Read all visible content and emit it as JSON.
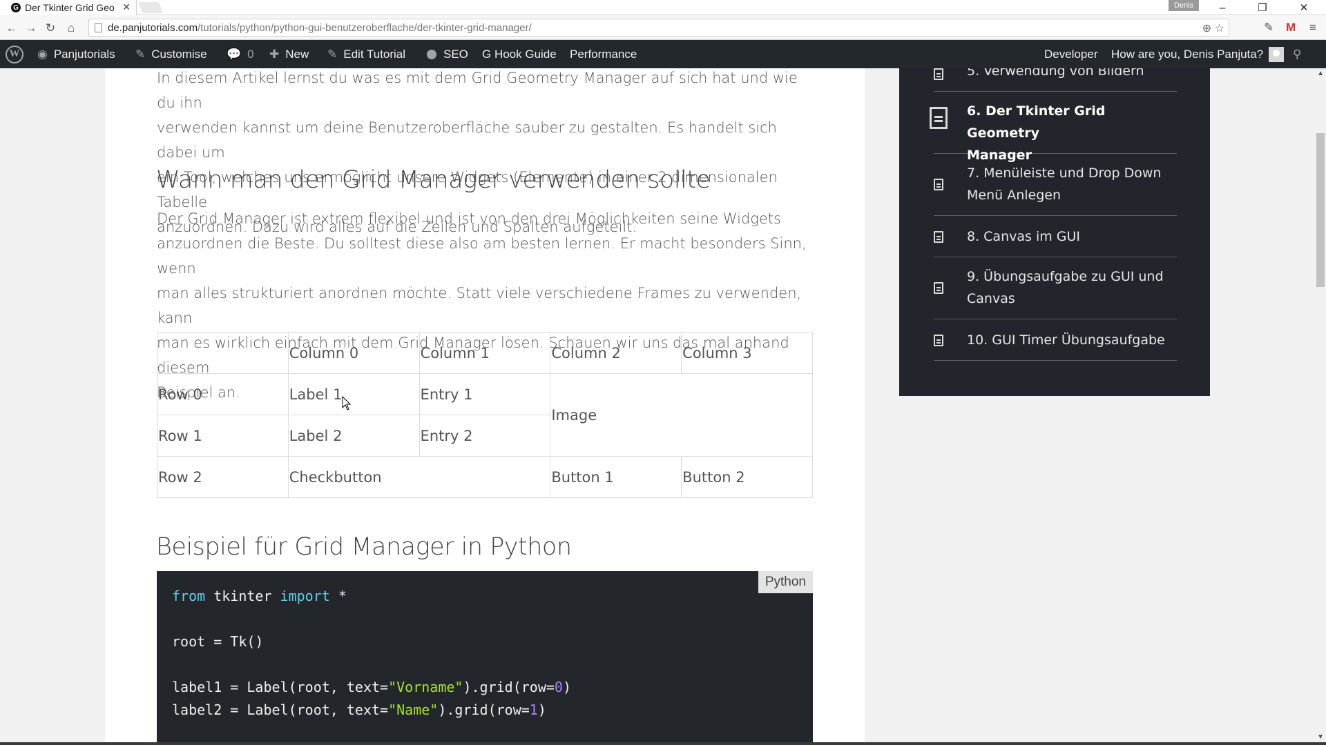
{
  "browser": {
    "tab_title": "Der Tkinter Grid Geo",
    "favicon_letter": "G",
    "profile_name": "Denis",
    "url_host": "de.panjutorials.com",
    "url_path": "/tutorials/python/python-gui-benutzeroberflache/der-tkinter-grid-manager/"
  },
  "adminbar": {
    "site_name": "Panjutorials",
    "customise": "Customise",
    "comments_count": "0",
    "new": "New",
    "edit": "Edit Tutorial",
    "seo": "SEO",
    "hook_guide": "G Hook Guide",
    "performance": "Performance",
    "developer": "Developer",
    "greeting": "How are you, Denis Panjuta?"
  },
  "article": {
    "intro": "In diesem Artikel lernst du was es mit dem Grid Geometry Manager auf sich hat und wie du ihn verwenden kannst um deine Benutzeroberfläche sauber zu gestalten. Es handelt sich dabei um ein Tool, welches uns ermöglicht unsere Widgets (Elemente) in einer 2 dimensionalen Tabelle anzuordnen. Dazu wird alles auf die Zeilen und Spalten aufgeteilt.",
    "intro_lines": [
      "In diesem Artikel lernst du was es mit dem Grid Geometry Manager auf sich hat und wie du ihn",
      "verwenden kannst um deine Benutzeroberfläche sauber zu gestalten. Es handelt sich dabei um",
      "ein Tool, welches uns ermöglicht unsere Widgets (Elemente) in einer 2 dimensionalen Tabelle",
      "anzuordnen. Dazu wird alles auf die Zeilen und Spalten aufgeteilt."
    ],
    "heading1": "Wann man den Grid Manager verwenden sollte",
    "para2_lines": [
      "Der Grid Manager ist extrem flexibel und ist von den drei Möglichkeiten seine Widgets",
      "anzuordnen die Beste. Du solltest diese also am besten lernen. Er macht besonders Sinn, wenn",
      "man alles strukturiert anordnen möchte. Statt viele verschiedene Frames zu verwenden, kann",
      "man es wirklich einfach mit dem Grid Manager lösen. Schauen wir uns das mal anhand diesem",
      "Beispiel an."
    ],
    "table": {
      "header": [
        "",
        "Column 0",
        "Column 1",
        "Column 2",
        "Column 3"
      ],
      "row0": [
        "Row 0",
        "Label 1",
        "Entry 1",
        "Image"
      ],
      "row1": [
        "Row 1",
        "Label 2",
        "Entry 2"
      ],
      "row2": [
        "Row 2",
        "Checkbutton",
        "Button 1",
        "Button 2"
      ]
    },
    "heading2": "Beispiel für Grid Manager in Python",
    "code_lang": "Python",
    "code": {
      "l1_from": "from",
      "l1_mod": " tkinter ",
      "l1_import": "import",
      "l1_rest": " *",
      "l2": "root = Tk()",
      "l3_a": "label1 = Label(root, text=",
      "l3_str": "\"Vorname\"",
      "l3_b": ").grid(row=",
      "l3_num": "0",
      "l3_c": ")",
      "l4_a": "label2 = Label(root, text=",
      "l4_str": "\"Name\"",
      "l4_b": ").grid(row=",
      "l4_num": "1",
      "l4_c": ")"
    }
  },
  "sidebar": {
    "items": [
      {
        "label": "5. Verwendung von Bildern"
      },
      {
        "label_l1": "6. Der Tkinter Grid Geometry",
        "label_l2": "Manager"
      },
      {
        "label_l1": "7. Menüleiste und Drop Down",
        "label_l2": "Menü Anlegen"
      },
      {
        "label": "8. Canvas im GUI"
      },
      {
        "label_l1": "9. Übungsaufgabe zu GUI und",
        "label_l2": "Canvas"
      },
      {
        "label": "10. GUI Timer Übungsaufgabe"
      }
    ]
  },
  "colors": {
    "adminbar": "#23282d",
    "sidebar": "#22262c",
    "code_bg": "#23262b",
    "keyword": "#5ed1e8",
    "string": "#a6e22e",
    "number": "#ae81ff"
  }
}
